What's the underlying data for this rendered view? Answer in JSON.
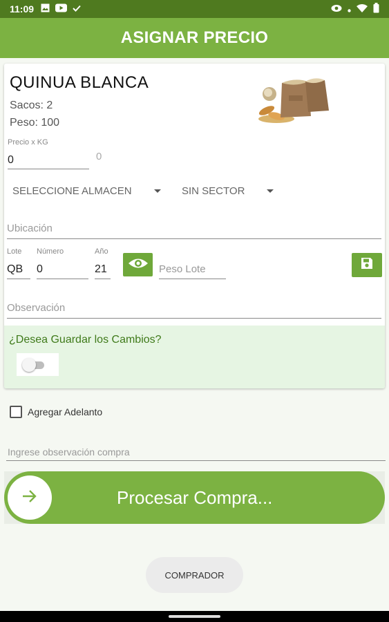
{
  "status_bar": {
    "time": "11:09",
    "left_icons": [
      "image-icon",
      "youtube-icon",
      "check-icon"
    ],
    "right_icons": [
      "eye-icon",
      "dot-icon",
      "wifi-icon",
      "battery-icon"
    ]
  },
  "app_bar": {
    "title": "ASIGNAR PRECIO"
  },
  "product": {
    "name": "QUINUA BLANCA",
    "sacos": "Sacos: 2",
    "peso": "Peso: 100",
    "image": "sacks-of-grain-image"
  },
  "price": {
    "label": "Precio x KG",
    "value": "0",
    "total": "0"
  },
  "dropdowns": {
    "almacen": "SELECCIONE ALMACEN",
    "sector": "SIN SECTOR"
  },
  "ubicacion": {
    "placeholder": "Ubicación"
  },
  "lote": {
    "lote_label": "Lote",
    "lote_value": "QB",
    "numero_label": "Número",
    "numero_value": "0",
    "anio_label": "Año",
    "anio_value": "21",
    "peso_lote_placeholder": "Peso Lote"
  },
  "observacion": {
    "placeholder": "Observación"
  },
  "save_panel": {
    "question": "¿Desea Guardar los Cambios?",
    "toggle_on": false
  },
  "adelanto": {
    "label": "Agregar Adelanto",
    "checked": false
  },
  "observacion_compra": {
    "placeholder": "Ingrese observación compra"
  },
  "process": {
    "label": "Procesar Compra..."
  },
  "comprador": {
    "label": "COMPRADOR"
  },
  "colors": {
    "primary": "#7cb242",
    "status_bar": "#4f7a1f",
    "save_panel_bg": "#e6f5e3",
    "question_text": "#3f7a1a"
  }
}
